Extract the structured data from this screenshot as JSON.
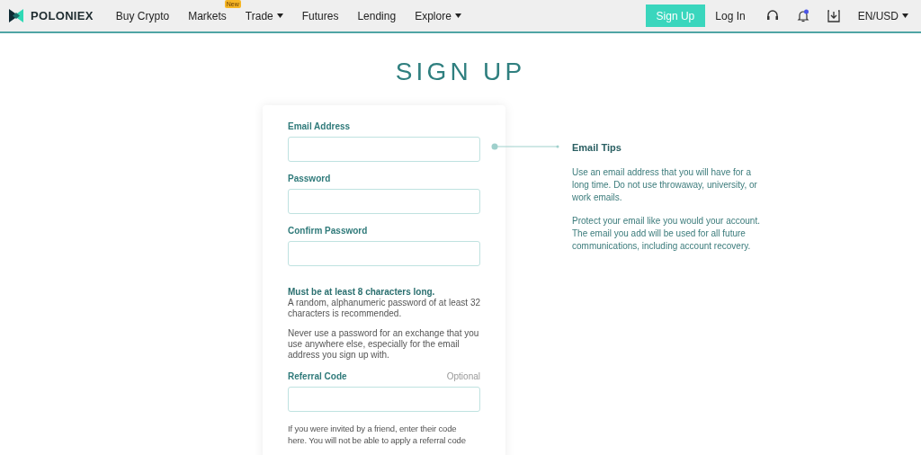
{
  "header": {
    "brand": "POLONIEX",
    "nav": [
      {
        "label": "Buy Crypto",
        "dropdown": false
      },
      {
        "label": "Markets",
        "dropdown": false,
        "badge": "New"
      },
      {
        "label": "Trade",
        "dropdown": true
      },
      {
        "label": "Futures",
        "dropdown": false
      },
      {
        "label": "Lending",
        "dropdown": false
      },
      {
        "label": "Explore",
        "dropdown": true
      }
    ],
    "signup_button": "Sign Up",
    "login_link": "Log In",
    "notification_unread": true,
    "locale": "EN/USD"
  },
  "title": "SIGN UP",
  "form": {
    "fields": [
      {
        "label": "Email Address"
      },
      {
        "label": "Password"
      },
      {
        "label": "Confirm Password"
      }
    ],
    "password_rule": "Must be at least 8 characters long.",
    "password_notes": [
      "A random, alphanumeric password of at least 32 characters is recommended.",
      "Never use a password for an exchange that you use anywhere else, especially for the email address you sign up with."
    ],
    "referral": {
      "label": "Referral Code",
      "hint": "Optional",
      "note": "If you were invited by a friend, enter their code here. You will not be able to apply a referral code"
    }
  },
  "tips": {
    "title": "Email Tips",
    "paragraphs": [
      "Use an email address that you will have for a long time. Do not use throwaway, university, or work emails.",
      "Protect your email like you would your account. The email you add will be used for all future communications, including account recovery."
    ]
  }
}
